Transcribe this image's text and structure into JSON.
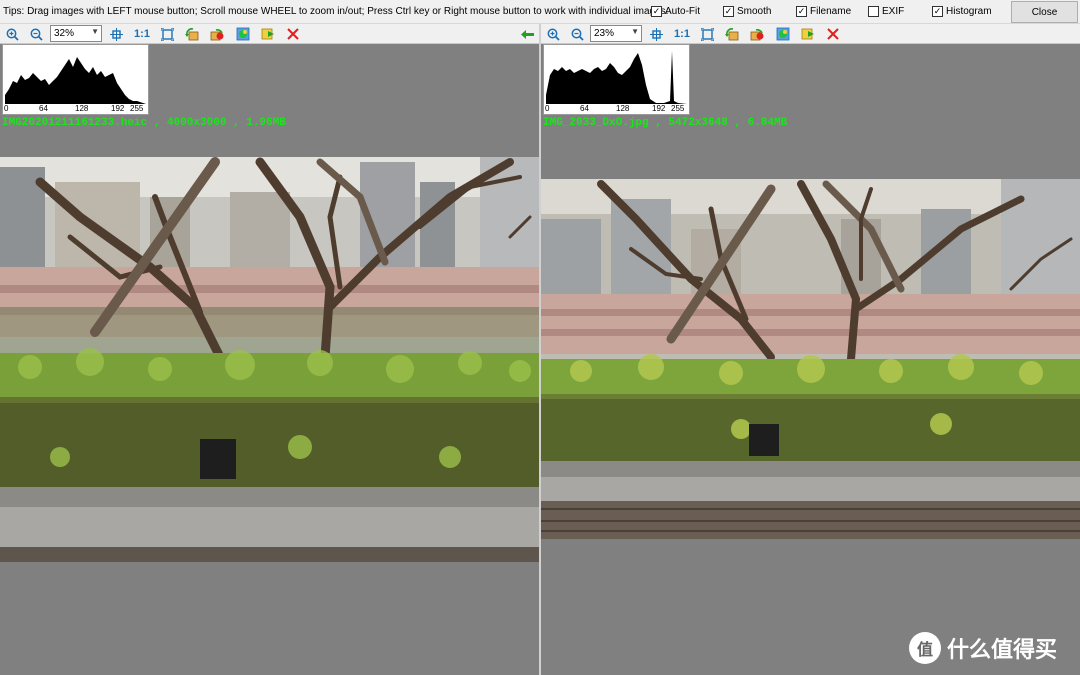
{
  "topbar": {
    "tips": "Tips: Drag images with LEFT mouse button; Scroll mouse WHEEL to zoom in/out; Press Ctrl key or Right mouse button to work with individual images.",
    "options": [
      {
        "label": "Auto-Fit",
        "checked": true
      },
      {
        "label": "Smooth",
        "checked": true
      },
      {
        "label": "Filename",
        "checked": true
      },
      {
        "label": "EXIF",
        "checked": false
      },
      {
        "label": "Histogram",
        "checked": true
      }
    ],
    "close_label": "Close"
  },
  "left": {
    "zoom": "32%",
    "fit_label": "1:1",
    "hist_ticks": [
      "0",
      "64",
      "128",
      "192",
      "255"
    ],
    "file_info": "IMG20201211161233.heic , 4000x3000 , 1.96MB"
  },
  "right": {
    "zoom": "23%",
    "fit_label": "1:1",
    "hist_ticks": [
      "0",
      "64",
      "128",
      "192",
      "255"
    ],
    "file_info": "IMG_2033_DxO.jpg , 5472x3648 , 6.84MB"
  },
  "watermark": {
    "logo_char": "值",
    "text": "什么值得买"
  },
  "colors": {
    "accent": "#1a6fb5",
    "file_info": "#19e619",
    "panel_bg": "#808080",
    "close_x": "#e02020",
    "sync_arrow": "#22a022"
  },
  "icons": [
    "zoom-in-icon",
    "zoom-out-icon",
    "zoom-dropdown-icon",
    "fit-center-icon",
    "actual-size-icon",
    "fit-window-icon",
    "rotate-left-icon",
    "rotate-right-icon",
    "prev-image-icon",
    "next-image-icon",
    "close-image-icon",
    "sync-arrow-icon"
  ]
}
